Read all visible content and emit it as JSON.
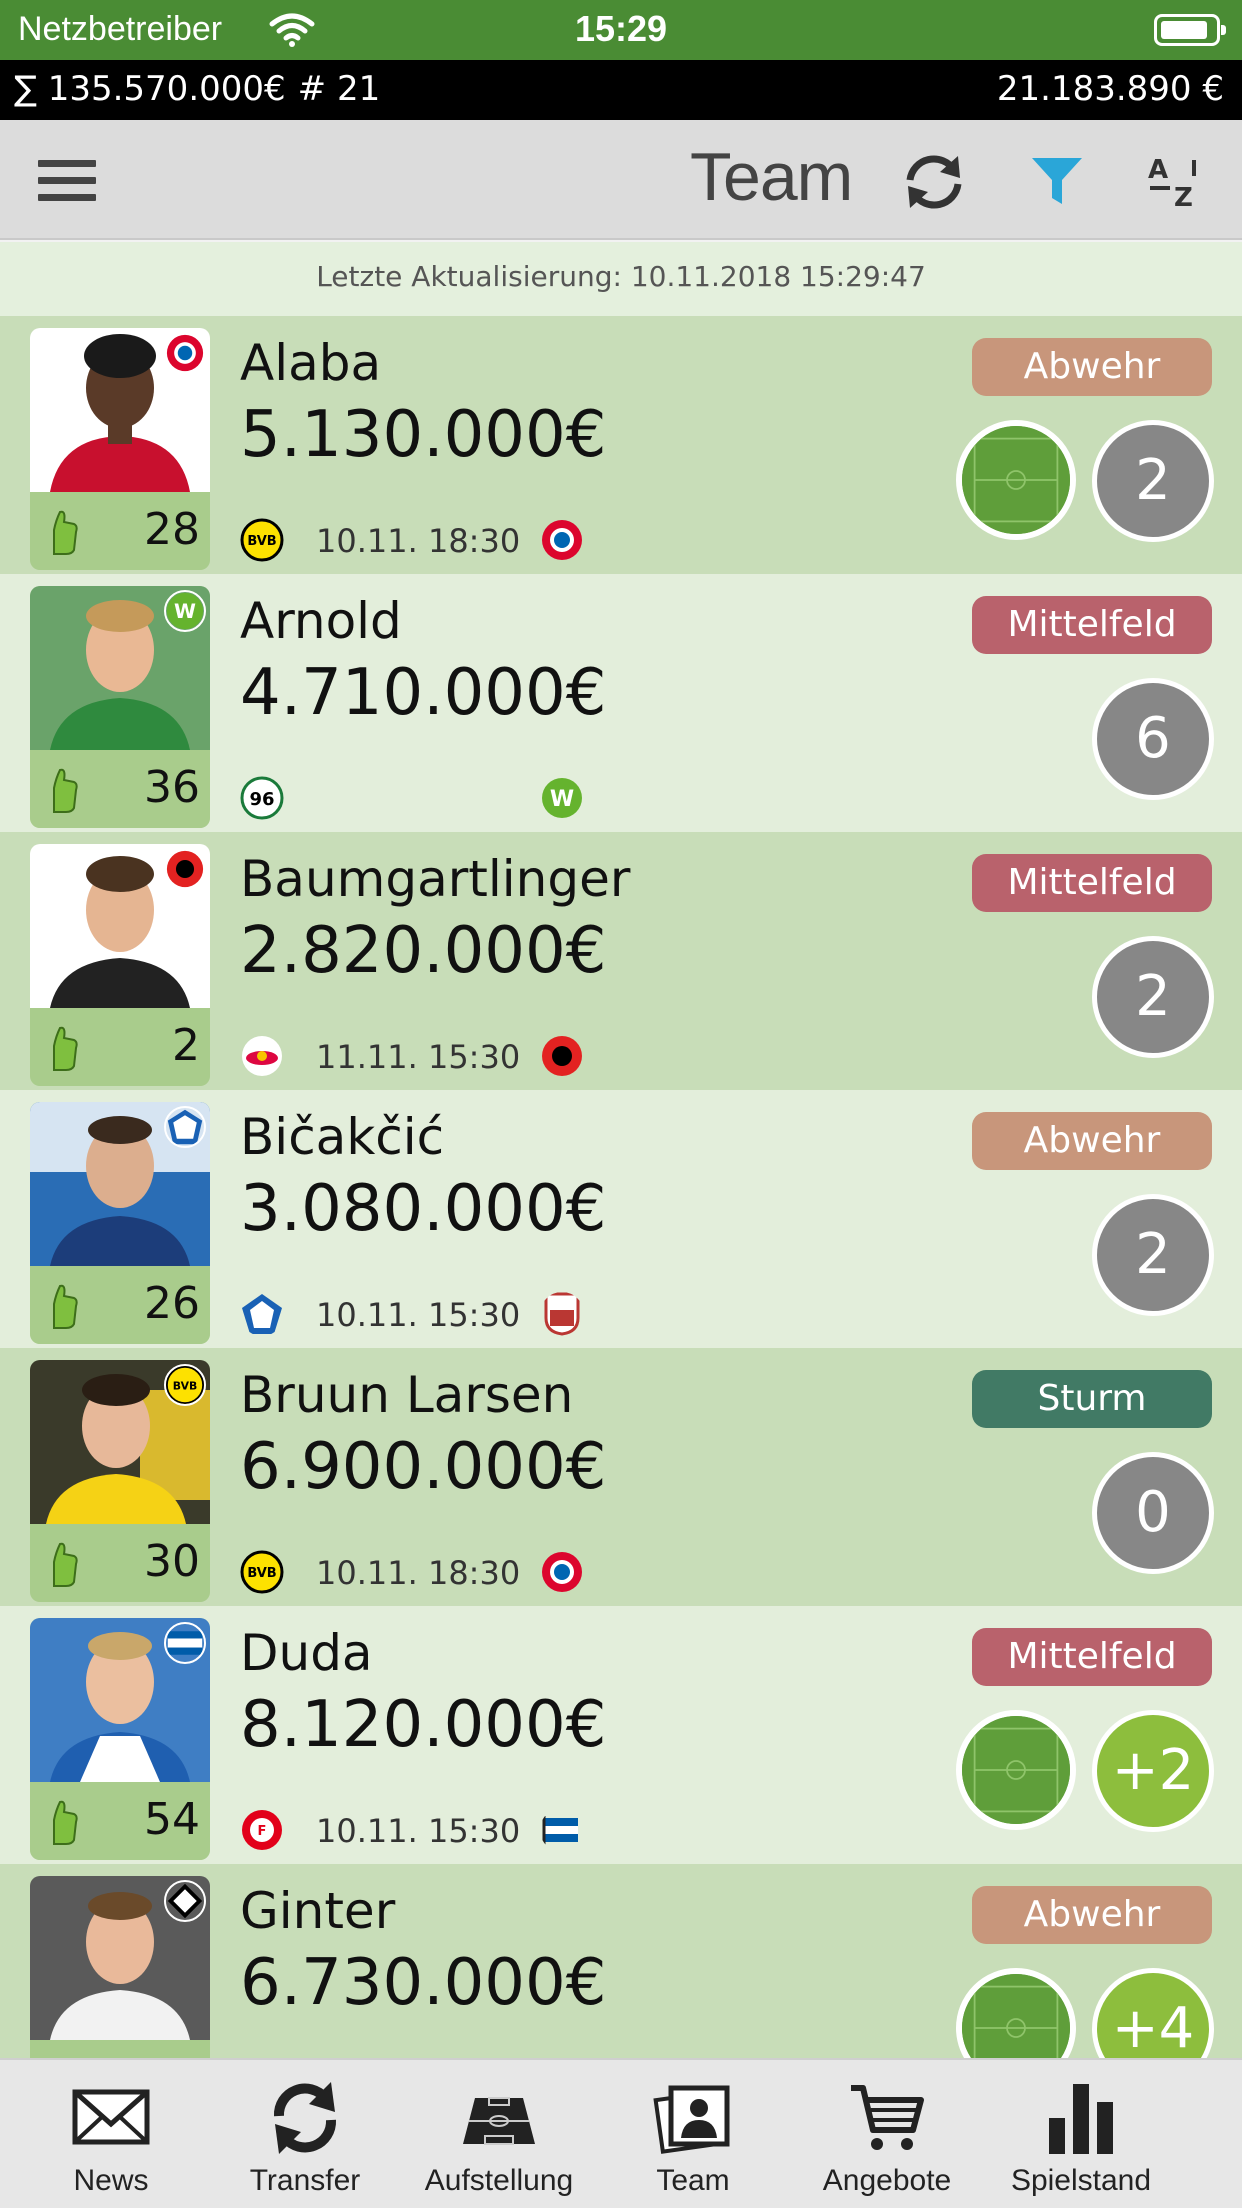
{
  "status_bar": {
    "carrier": "Netzbetreiber",
    "time": "15:29"
  },
  "budget_bar": {
    "total_value": "∑ 135.570.000€",
    "count": "# 21",
    "balance": "21.183.890 €"
  },
  "nav": {
    "title": "Team"
  },
  "update": {
    "text": "Letzte Aktualisierung: 10.11.2018 15:29:47"
  },
  "colors": {
    "statusbar": "#4a8c34",
    "row_dark": "#c8ddb8",
    "row_light": "#e3eedb",
    "abwehr": "#c8967b",
    "mittelfeld": "#b9626c",
    "sturm": "#417a65",
    "score_grey": "#878787",
    "score_green": "#8dbe3d",
    "filter_active": "#2aa6d8"
  },
  "players": [
    {
      "name": "Alaba",
      "value": "5.130.000€",
      "points": "28",
      "position": "Abwehr",
      "score": "2",
      "match_time": "10.11. 18:30",
      "home_club": "BVB",
      "away_club": "FC Bayern",
      "club_badge": "FC Bayern",
      "in_lineup": true
    },
    {
      "name": "Arnold",
      "value": "4.710.000€",
      "points": "36",
      "position": "Mittelfeld",
      "score": "6",
      "match_time": "",
      "home_club": "Hannover 96",
      "away_club": "VfL Wolfsburg",
      "club_badge": "VfL Wolfsburg",
      "in_lineup": false
    },
    {
      "name": "Baumgartlinger",
      "value": "2.820.000€",
      "points": "2",
      "position": "Mittelfeld",
      "score": "2",
      "match_time": "11.11. 15:30",
      "home_club": "RB Leipzig",
      "away_club": "Bayer Leverkusen",
      "club_badge": "Bayer Leverkusen",
      "in_lineup": false
    },
    {
      "name": "Bičakčić",
      "value": "3.080.000€",
      "points": "26",
      "position": "Abwehr",
      "score": "2",
      "match_time": "10.11. 15:30",
      "home_club": "TSG Hoffenheim",
      "away_club": "FC Augsburg",
      "club_badge": "TSG Hoffenheim",
      "in_lineup": false
    },
    {
      "name": "Bruun Larsen",
      "value": "6.900.000€",
      "points": "30",
      "position": "Sturm",
      "score": "0",
      "match_time": "10.11. 18:30",
      "home_club": "BVB",
      "away_club": "FC Bayern",
      "club_badge": "BVB",
      "in_lineup": false
    },
    {
      "name": "Duda",
      "value": "8.120.000€",
      "points": "54",
      "position": "Mittelfeld",
      "score": "+2",
      "match_time": "10.11. 15:30",
      "home_club": "Fortuna Düsseldorf",
      "away_club": "Hertha BSC",
      "club_badge": "Hertha BSC",
      "in_lineup": true
    },
    {
      "name": "Ginter",
      "value": "6.730.000€",
      "points": "",
      "position": "Abwehr",
      "score": "+4",
      "match_time": "",
      "home_club": "",
      "away_club": "",
      "club_badge": "Borussia Mönchengladbach",
      "in_lineup": true
    }
  ],
  "tabs": [
    {
      "label": "News",
      "icon": "envelope-icon"
    },
    {
      "label": "Transfer",
      "icon": "transfer-arrows-icon"
    },
    {
      "label": "Aufstellung",
      "icon": "pitch-icon"
    },
    {
      "label": "Team",
      "icon": "player-card-icon"
    },
    {
      "label": "Angebote",
      "icon": "cart-icon"
    },
    {
      "label": "Spielstand",
      "icon": "bar-chart-icon"
    }
  ]
}
